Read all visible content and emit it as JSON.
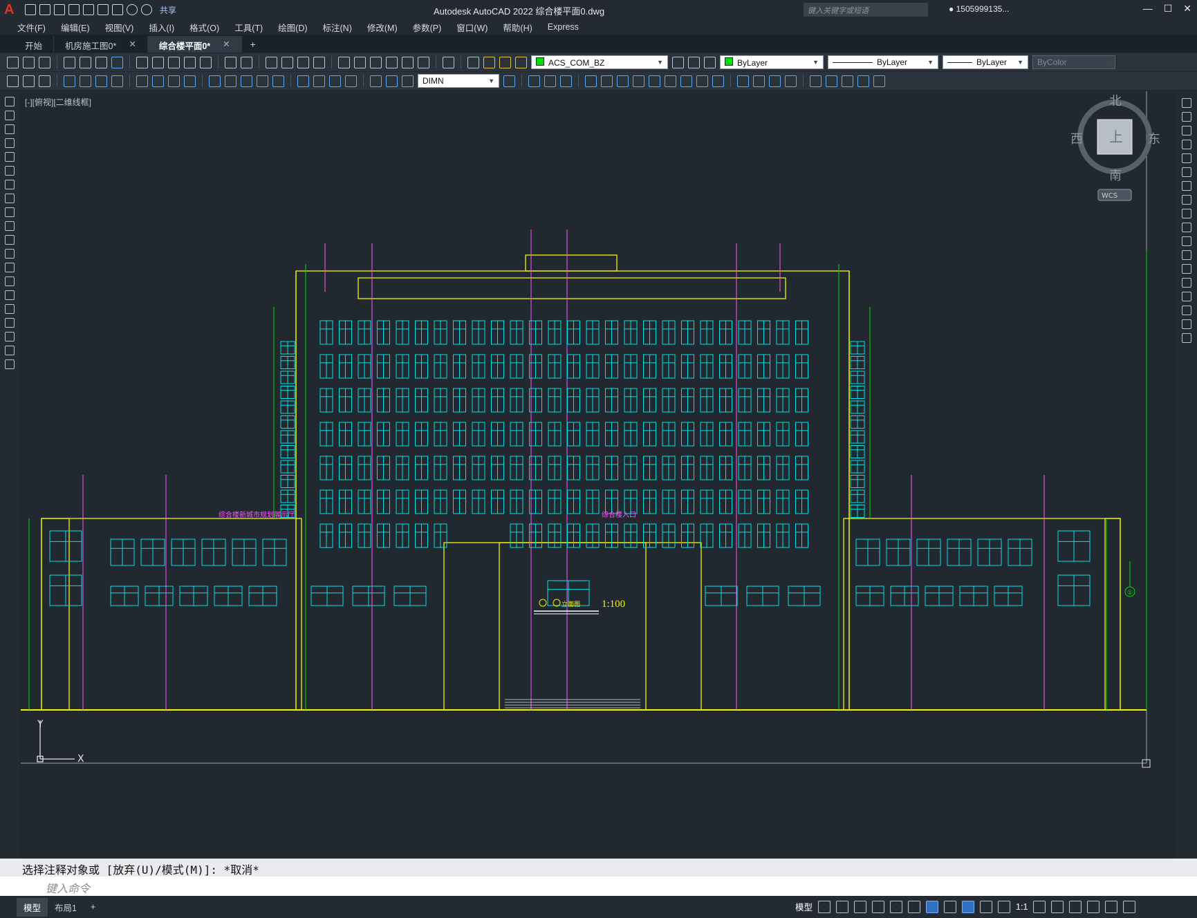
{
  "app": {
    "title": "Autodesk AutoCAD 2022    综合楼平面0.dwg",
    "share_label": "共享",
    "search_placeholder": "键入关键字或短语",
    "user": "1505999135...",
    "brand_color": "#e0322a"
  },
  "menu": [
    "文件(F)",
    "编辑(E)",
    "视图(V)",
    "插入(I)",
    "格式(O)",
    "工具(T)",
    "绘图(D)",
    "标注(N)",
    "修改(M)",
    "参数(P)",
    "窗口(W)",
    "帮助(H)",
    "Express"
  ],
  "tabs": [
    {
      "label": "开始",
      "closable": false,
      "active": false
    },
    {
      "label": "机房施工图0*",
      "closable": true,
      "active": false
    },
    {
      "label": "综合楼平面0*",
      "closable": true,
      "active": true
    }
  ],
  "toolbar": {
    "layer": "ACS_COM_BZ",
    "color": "ByLayer",
    "linetype": "ByLayer",
    "lineweight": "ByLayer",
    "plotstyle": "ByColor",
    "dimstyle": "DIMN",
    "layer_swatch": "#00e000"
  },
  "viewport": {
    "label": "[-][俯视][二维线框]",
    "scale_label": "1:100",
    "view_title": "立面图"
  },
  "viewcube": {
    "north": "北",
    "south": "南",
    "east": "东",
    "west": "西",
    "face": "上",
    "wcs": "WCS"
  },
  "ucs": {
    "x": "X",
    "y": "Y"
  },
  "command": {
    "history": "选择注释对象或 [放弃(U)/模式(M)]: *取消*",
    "placeholder": "键入命令"
  },
  "layout_tabs": [
    {
      "label": "模型",
      "active": true
    },
    {
      "label": "布局1",
      "active": false
    }
  ],
  "status": {
    "model_label": "模型",
    "scale": "1:1"
  },
  "drawing_colors": {
    "windows": "#00e5e5",
    "outline": "#f5f500",
    "dims": "#00dd00",
    "pipes": "#ff55ff",
    "annotation": "#ff55ff"
  },
  "annotations": {
    "left_sign": "综合楼新城市规划展示厅",
    "center_sign": "综合楼入口",
    "grid_mark": "①"
  }
}
